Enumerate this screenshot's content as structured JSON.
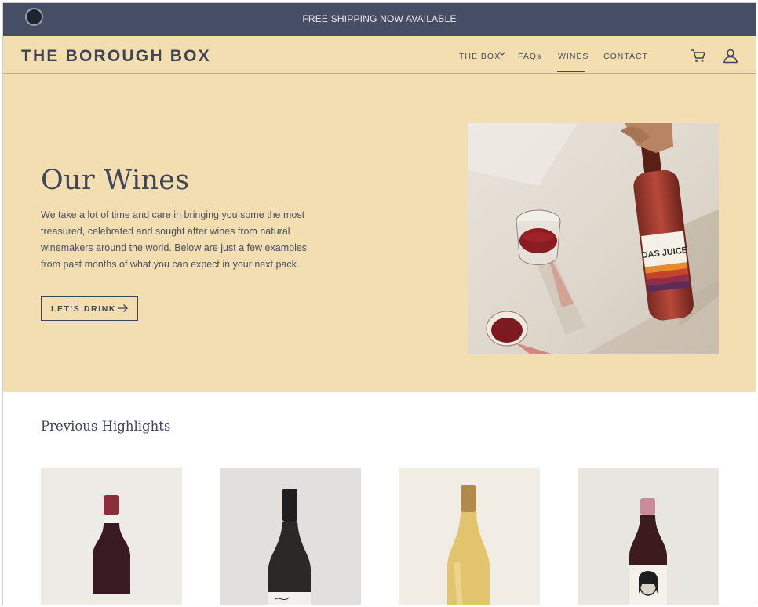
{
  "announcement": {
    "text": "FREE SHIPPING NOW AVAILABLE"
  },
  "header": {
    "logo": "THE BOROUGH BOX",
    "nav": [
      {
        "label": "THE BOX"
      },
      {
        "label": "FAQs"
      },
      {
        "label": "WINES"
      },
      {
        "label": "CONTACT"
      }
    ],
    "active_nav": "WINES"
  },
  "hero": {
    "title": "Our Wines",
    "description": "We take a lot of time and care in bringing you some the most treasured, celebrated and sought after wines from natural winemakers around the world. Below are just a few examples from past months of what you can expect in your next pack.",
    "cta_label": "LET'S DRINK",
    "image_label": "DAS JUICE"
  },
  "highlights": {
    "title": "Previous Highlights",
    "products": [
      {
        "image": "dark-red-wine-bottle"
      },
      {
        "image": "dark-bottle-white-label"
      },
      {
        "image": "golden-white-wine-bottle"
      },
      {
        "image": "red-wine-portrait-label-bottle"
      }
    ]
  },
  "colors": {
    "announcement_bg": "#464e65",
    "header_bg": "#f2deb0",
    "text": "#3f4659",
    "background": "#ffffff"
  }
}
